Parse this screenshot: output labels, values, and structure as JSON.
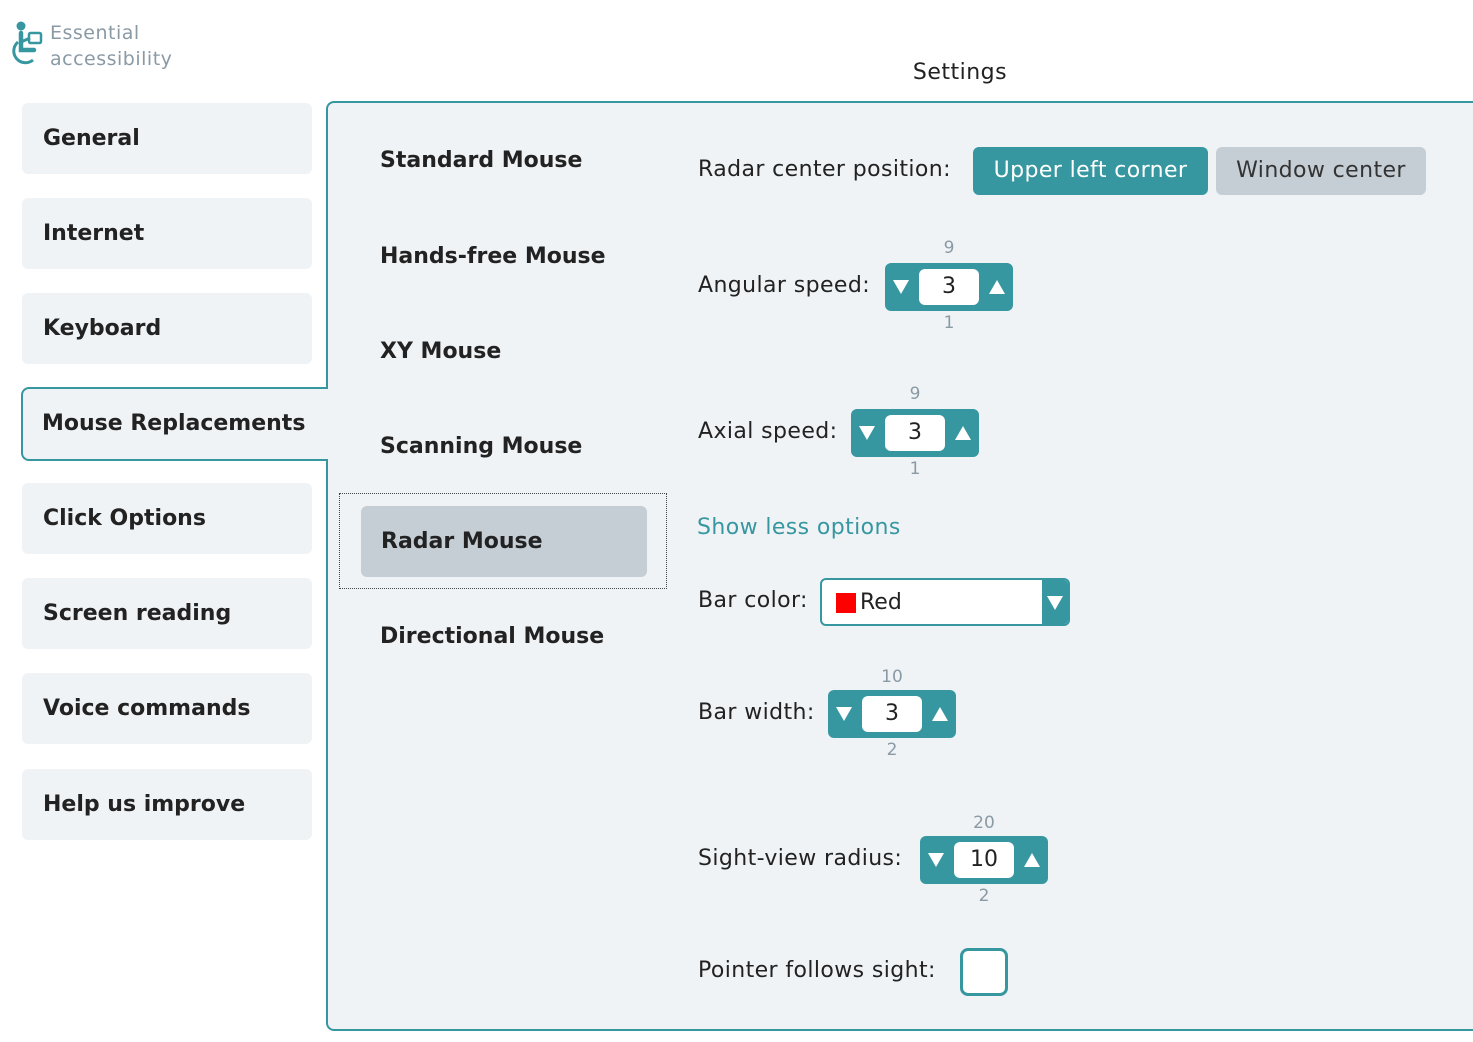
{
  "app": {
    "logo_line1": "Essential",
    "logo_line2": "accessibility",
    "page_title": "Settings",
    "accent_color": "#3797a0"
  },
  "nav": {
    "items": [
      {
        "label": "General"
      },
      {
        "label": "Internet"
      },
      {
        "label": "Keyboard"
      },
      {
        "label": "Mouse Replacements",
        "active": true
      },
      {
        "label": "Click Options"
      },
      {
        "label": "Screen reading"
      },
      {
        "label": "Voice commands"
      },
      {
        "label": "Help us improve"
      }
    ]
  },
  "mouse_types": {
    "items": [
      {
        "label": "Standard Mouse"
      },
      {
        "label": "Hands-free Mouse"
      },
      {
        "label": "XY Mouse"
      },
      {
        "label": "Scanning Mouse"
      },
      {
        "label": "Radar Mouse",
        "selected": true
      },
      {
        "label": "Directional Mouse"
      }
    ]
  },
  "settings": {
    "radar_center": {
      "label": "Radar center position:",
      "options": [
        "Upper left corner",
        "Window center"
      ],
      "selected": "Upper left corner"
    },
    "angular_speed": {
      "label": "Angular speed:",
      "value": "3",
      "max": "9",
      "min": "1"
    },
    "axial_speed": {
      "label": "Axial speed:",
      "value": "3",
      "max": "9",
      "min": "1"
    },
    "toggle_options_link": "Show less options",
    "bar_color": {
      "label": "Bar color:",
      "value": "Red",
      "swatch_color": "#ff0000"
    },
    "bar_width": {
      "label": "Bar width:",
      "value": "3",
      "max": "10",
      "min": "2"
    },
    "sight_view_radius": {
      "label": "Sight-view radius:",
      "value": "10",
      "max": "20",
      "min": "2"
    },
    "pointer_follows_sight": {
      "label": "Pointer follows sight:",
      "checked": false
    }
  }
}
